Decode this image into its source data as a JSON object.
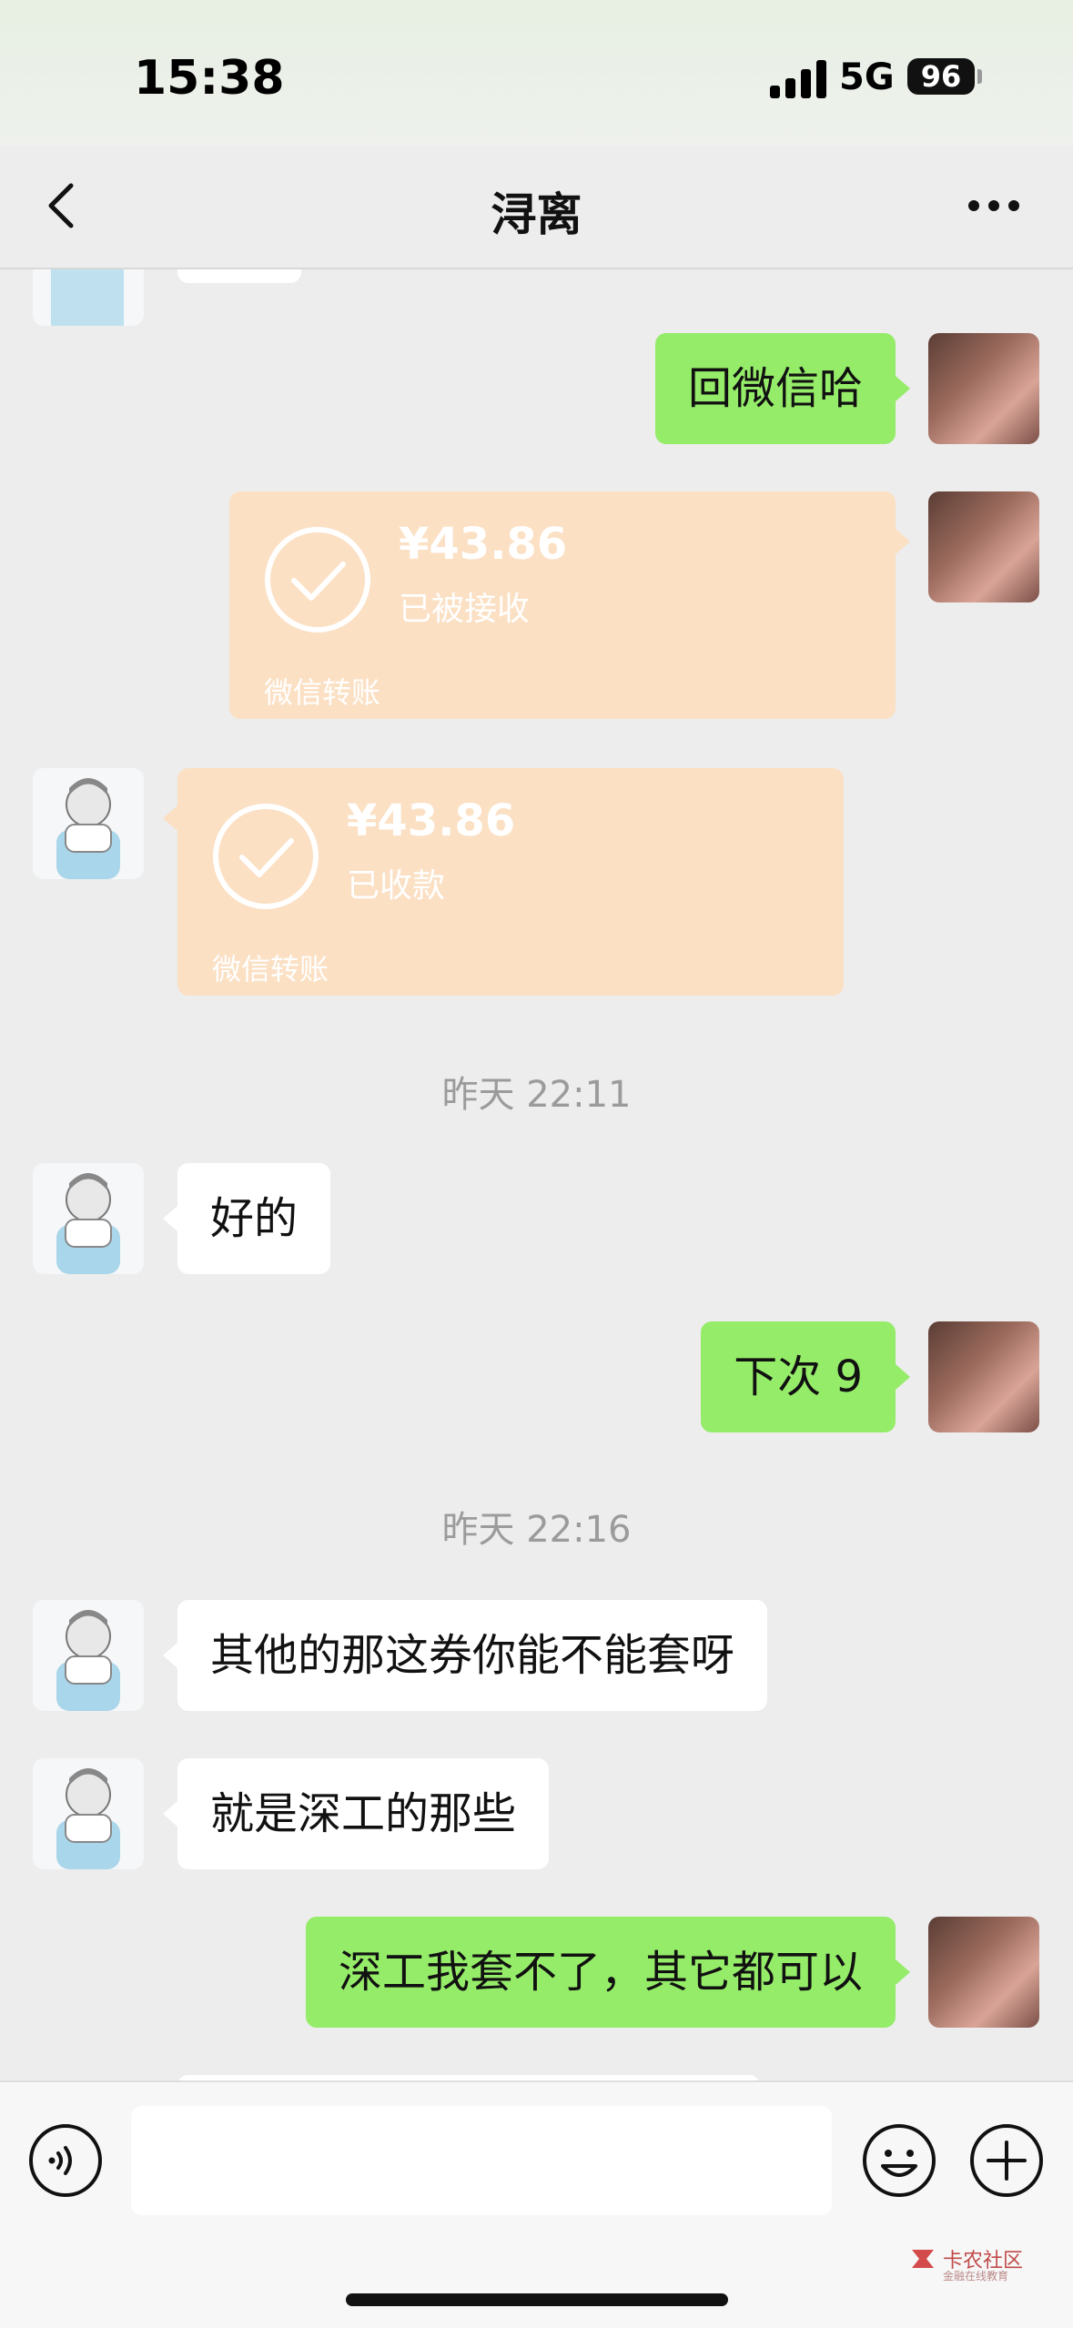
{
  "status_bar": {
    "time": "15:38",
    "network": "5G",
    "battery": "96"
  },
  "nav": {
    "title": "浔离"
  },
  "chat": {
    "msg_1": "回微信哈",
    "transfer_1": {
      "amount": "¥43.86",
      "status": "已被接收",
      "label": "微信转账"
    },
    "transfer_2": {
      "amount": "¥43.86",
      "status": "已收款",
      "label": "微信转账"
    },
    "time_1": "昨天 22:11",
    "msg_2": "好的",
    "msg_3": "下次 9",
    "time_2": "昨天 22:16",
    "msg_4": "其他的那这券你能不能套呀",
    "msg_5": "就是深工的那些",
    "msg_6": "深工我套不了，其它都可以"
  },
  "input": {
    "placeholder": ""
  },
  "watermark": {
    "text": "卡农社区",
    "sub": "金融在线教育"
  },
  "colors": {
    "sent_bubble": "#95ec69",
    "received_bubble": "#ffffff",
    "transfer": "#fbe0c4",
    "background": "#ededed"
  }
}
